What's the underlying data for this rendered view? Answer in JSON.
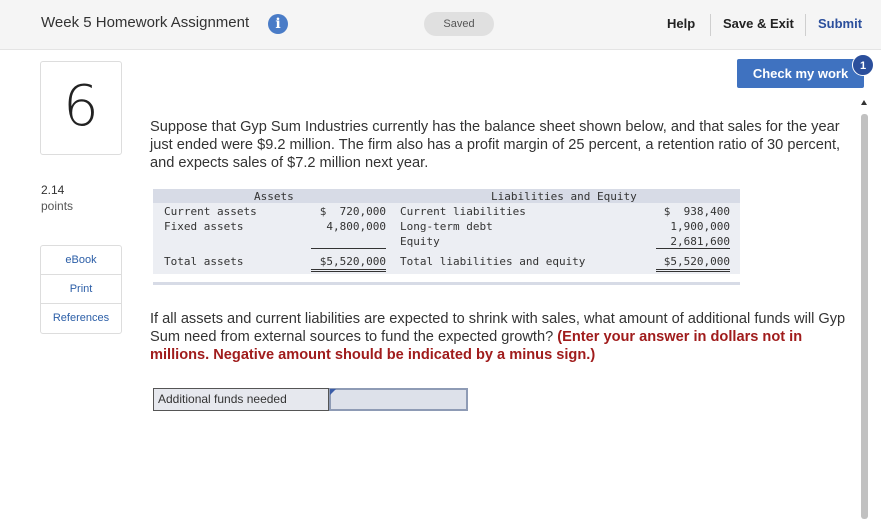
{
  "header": {
    "title": "Week 5 Homework Assignment",
    "info_icon": "i",
    "saved": "Saved",
    "help": "Help",
    "save_exit": "Save & Exit",
    "submit": "Submit"
  },
  "check_work": {
    "label": "Check my work",
    "badge": "1"
  },
  "question": {
    "number": "6",
    "points_value": "2.14",
    "points_label": "points",
    "side_links": [
      "eBook",
      "Print",
      "References"
    ],
    "intro": "Suppose that Gyp Sum Industries currently has the balance sheet shown below, and that sales for the year just ended were $9.2 million. The firm also has a profit margin of 25 percent, a retention ratio of 30 percent, and expects sales of $7.2 million next year.",
    "prompt": "If all assets and current liabilities are expected to shrink with sales, what amount of additional funds will Gyp Sum need from external sources to fund the expected growth?",
    "instruction": "(Enter your answer in dollars not in millions. Negative amount should be indicated by a minus sign.)"
  },
  "balance_sheet": {
    "assets_header": "Assets",
    "liab_header": "Liabilities and Equity",
    "assets": [
      {
        "label": "Current assets",
        "value": "$  720,000"
      },
      {
        "label": "Fixed assets",
        "value": "4,800,000"
      }
    ],
    "liabilities": [
      {
        "label": "Current liabilities",
        "value": "$  938,400"
      },
      {
        "label": "Long-term debt",
        "value": "1,900,000"
      },
      {
        "label": "Equity",
        "value": "2,681,600"
      }
    ],
    "total_assets_label": "Total assets",
    "total_assets_value": "$5,520,000",
    "total_liab_label": "Total liabilities and equity",
    "total_liab_value": "$5,520,000"
  },
  "answer": {
    "label": "Additional funds needed",
    "value": ""
  },
  "colors": {
    "accent": "#3f72c0",
    "emphasis": "#a01c1c",
    "link": "#2b5ea7"
  }
}
